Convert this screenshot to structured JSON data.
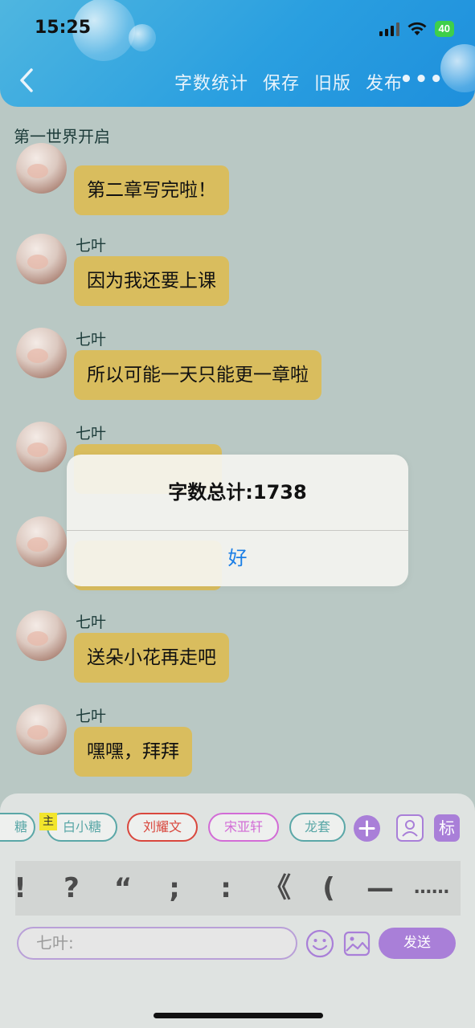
{
  "status_bar": {
    "time": "15:25",
    "battery": "40"
  },
  "header": {
    "back_icon": "chevron-left-icon",
    "nav": [
      "字数统计",
      "保存",
      "旧版",
      "发布"
    ],
    "more": "•••"
  },
  "chapter_title": "第一世界开启",
  "messages": [
    {
      "name": "",
      "text": "第二章写完啦！"
    },
    {
      "name": "七叶",
      "text": "因为我还要上课"
    },
    {
      "name": "七叶",
      "text": "所以可能一天只能更一章啦"
    },
    {
      "name": "七叶",
      "text": ""
    },
    {
      "name": "",
      "text": ""
    },
    {
      "name": "七叶",
      "text": "送朵小花再走吧"
    },
    {
      "name": "七叶",
      "text": "嘿嘿，拜拜"
    }
  ],
  "dialog": {
    "title": "字数总计:1738",
    "ok": "好"
  },
  "roles": {
    "partial": "糖",
    "main_tag": "主",
    "chips": [
      "白小糖",
      "刘耀文",
      "宋亚轩",
      "龙套"
    ],
    "chip_colors": [
      "#5aa7a7",
      "#d9473d",
      "#d26cd6",
      "#5aa7a7"
    ],
    "add_icon": "plus-circle-icon",
    "person_icon": "person-card-icon",
    "mark_label": "标"
  },
  "punctuation": [
    "!",
    "?",
    "“",
    ";",
    ":",
    "《",
    "(",
    "—",
    "……"
  ],
  "input": {
    "placeholder": "七叶:",
    "emoji_icon": "smiley-icon",
    "image_icon": "image-icon",
    "send": "发送"
  },
  "colors": {
    "header": "#2a9fe0",
    "bubble": "#d9bd5e",
    "accent_purple": "#a97fd8",
    "dialog_button": "#1a7ee6"
  }
}
